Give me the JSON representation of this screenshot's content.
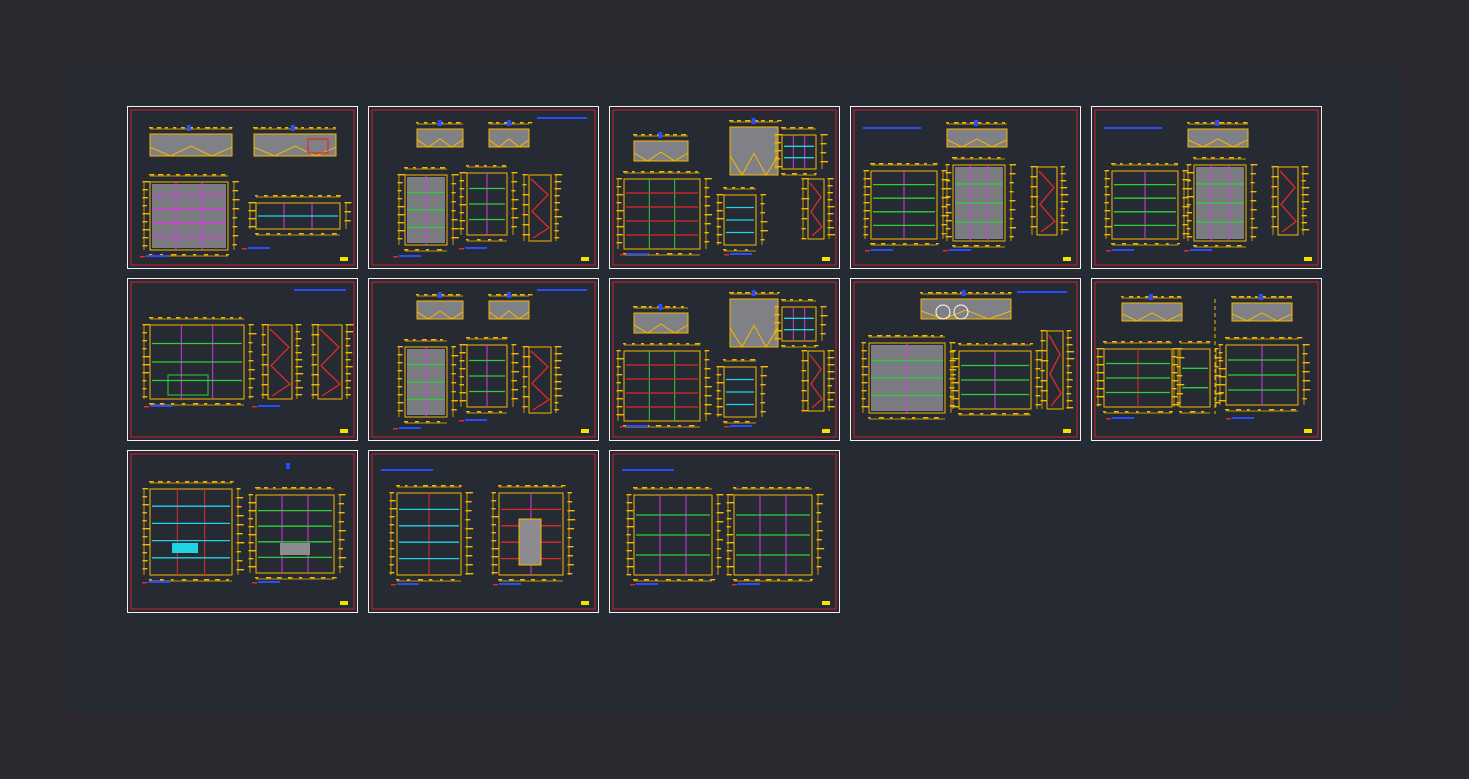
{
  "canvas": {
    "background": "#2b2830",
    "drawing_area_color": "#262a33"
  },
  "colors": {
    "sheet_border": "#f2f2f2",
    "frame": "#d11f2e",
    "dimension": "#f5b800",
    "shade": "#8b8b90",
    "green": "#2bd13a",
    "cyan": "#22d3e6",
    "magenta": "#d63adf",
    "red": "#e12a2a",
    "blue": "#2a4cff"
  },
  "sheets": [
    {
      "layout": "A",
      "title_block": true
    },
    {
      "layout": "B",
      "title_block": true
    },
    {
      "layout": "C",
      "title_block": true
    },
    {
      "layout": "D",
      "title_block": true
    },
    {
      "layout": "D",
      "title_block": true
    },
    {
      "layout": "E",
      "title_block": true
    },
    {
      "layout": "B",
      "title_block": true
    },
    {
      "layout": "C",
      "title_block": true
    },
    {
      "layout": "F",
      "title_block": true
    },
    {
      "layout": "G",
      "title_block": true
    },
    {
      "layout": "H",
      "title_block": true
    },
    {
      "layout": "I",
      "title_block": true
    },
    {
      "layout": "J",
      "title_block": true
    }
  ]
}
